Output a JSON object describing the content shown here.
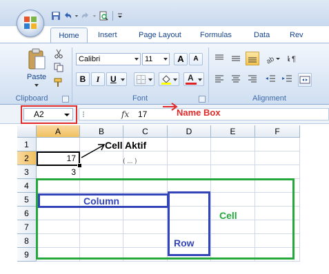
{
  "quick_access": {
    "icons": [
      "save-icon",
      "undo-icon",
      "redo-icon",
      "print-preview-icon",
      "customize-qat-icon"
    ]
  },
  "tabs": [
    {
      "label": "Home",
      "active": true
    },
    {
      "label": "Insert"
    },
    {
      "label": "Page Layout"
    },
    {
      "label": "Formulas"
    },
    {
      "label": "Data"
    },
    {
      "label": "Rev"
    }
  ],
  "ribbon": {
    "clipboard": {
      "label": "Clipboard",
      "paste_label": "Paste"
    },
    "font": {
      "label": "Font",
      "font_name": "Calibri",
      "font_size": "11",
      "grow_label": "A",
      "shrink_label": "A",
      "bold": "B",
      "italic": "I",
      "underline": "U",
      "font_color_label": "A"
    },
    "alignment": {
      "label": "Alignment"
    }
  },
  "formula_bar": {
    "name_box": "A2",
    "fx_label": "fx",
    "value": "17"
  },
  "grid": {
    "columns": [
      "A",
      "B",
      "C",
      "D",
      "E",
      "F"
    ],
    "rows": [
      "1",
      "2",
      "3",
      "4",
      "5",
      "6",
      "7",
      "8",
      "9"
    ],
    "cells": {
      "A2": "17",
      "A3": "3"
    },
    "selected_column": "A",
    "selected_row": "2"
  },
  "annotations": {
    "name_box": "Name Box",
    "cell_aktif": "Cell Aktif",
    "column": "Column",
    "row": "Row",
    "cell": "Cell",
    "handwritten": "( ... )"
  },
  "colors": {
    "red": "#e02a2a",
    "blue": "#3344b8",
    "green": "#25a83b",
    "ribbon_text": "#15428b"
  }
}
